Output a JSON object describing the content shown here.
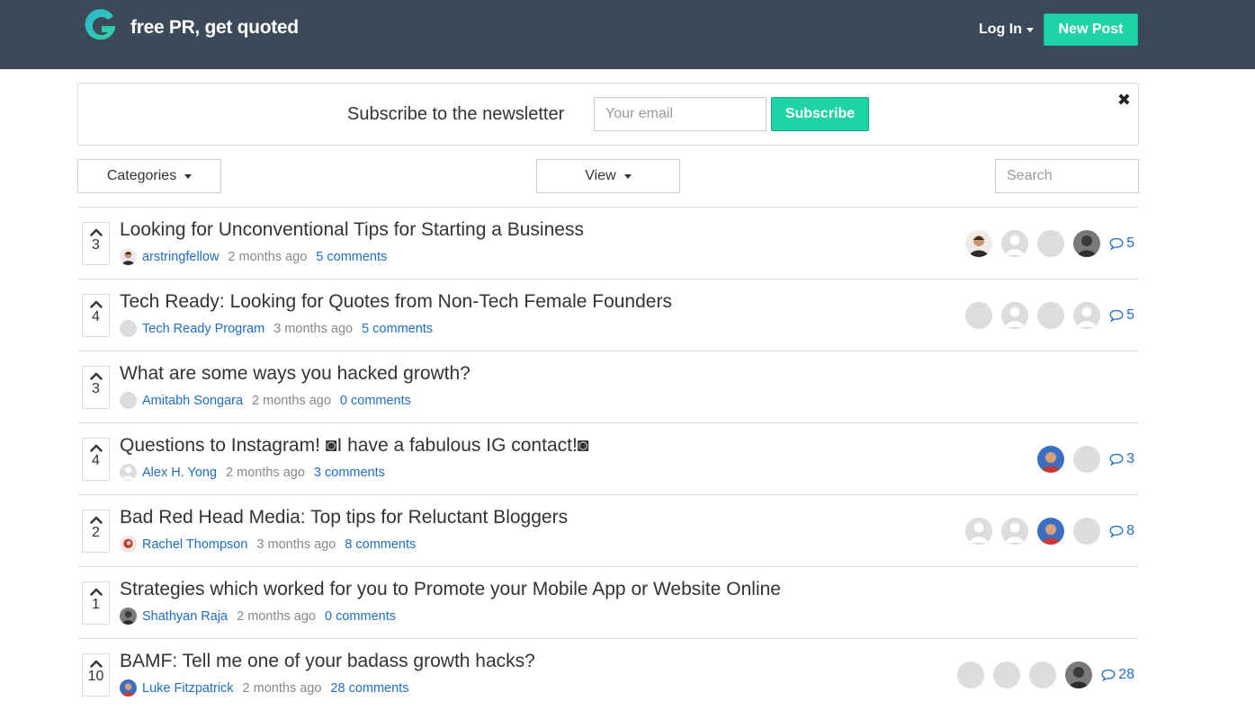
{
  "header": {
    "brand": "free PR, get quoted",
    "login_label": "Log In",
    "new_post_label": "New Post",
    "accent_color": "#1fd3a6",
    "bar_color": "#3b4a59"
  },
  "newsletter": {
    "title": "Subscribe to the newsletter",
    "email_placeholder": "Your email",
    "subscribe_label": "Subscribe",
    "close_glyph": "✖"
  },
  "controls": {
    "categories_label": "Categories",
    "view_label": "View",
    "search_placeholder": "Search"
  },
  "posts": [
    {
      "votes": "3",
      "title": "Looking for Unconventional Tips for Starting a Business",
      "author": "arstringfellow",
      "author_avatar": "photo",
      "time": "2 months ago",
      "comments": "5 comments",
      "participants": [
        "photo",
        "person",
        "blank",
        "dark"
      ],
      "count": "5"
    },
    {
      "votes": "4",
      "title": "Tech Ready: Looking for Quotes from Non-Tech Female Founders",
      "author": "Tech Ready Program",
      "author_avatar": "blank",
      "time": "3 months ago",
      "comments": "5 comments",
      "participants": [
        "blank",
        "person",
        "blank",
        "person"
      ],
      "count": "5"
    },
    {
      "votes": "3",
      "title": "What are some ways you hacked growth?",
      "author": "Amitabh Songara",
      "author_avatar": "blank",
      "time": "2 months ago",
      "comments": "0 comments",
      "participants": [],
      "count": ""
    },
    {
      "votes": "4",
      "title": "Questions to Instagram! ◙I have a fabulous IG contact!◙",
      "author": "Alex H. Yong",
      "author_avatar": "person",
      "time": "2 months ago",
      "comments": "3 comments",
      "participants": [
        "blue",
        "blank"
      ],
      "count": "3"
    },
    {
      "votes": "2",
      "title": "Bad Red Head Media: Top tips for Reluctant Bloggers",
      "author": "Rachel Thompson",
      "author_avatar": "red",
      "time": "3 months ago",
      "comments": "8 comments",
      "participants": [
        "person",
        "person",
        "blue",
        "blank"
      ],
      "count": "8"
    },
    {
      "votes": "1",
      "title": "Strategies which worked for you to Promote your Mobile App or Website Online",
      "author": "Shathyan Raja",
      "author_avatar": "dark",
      "time": "2 months ago",
      "comments": "0 comments",
      "participants": [],
      "count": ""
    },
    {
      "votes": "10",
      "title": "BAMF: Tell me one of your badass growth hacks?",
      "author": "Luke Fitzpatrick",
      "author_avatar": "blue",
      "time": "2 months ago",
      "comments": "28 comments",
      "participants": [
        "blank",
        "blank",
        "blank",
        "dark"
      ],
      "count": "28"
    }
  ]
}
